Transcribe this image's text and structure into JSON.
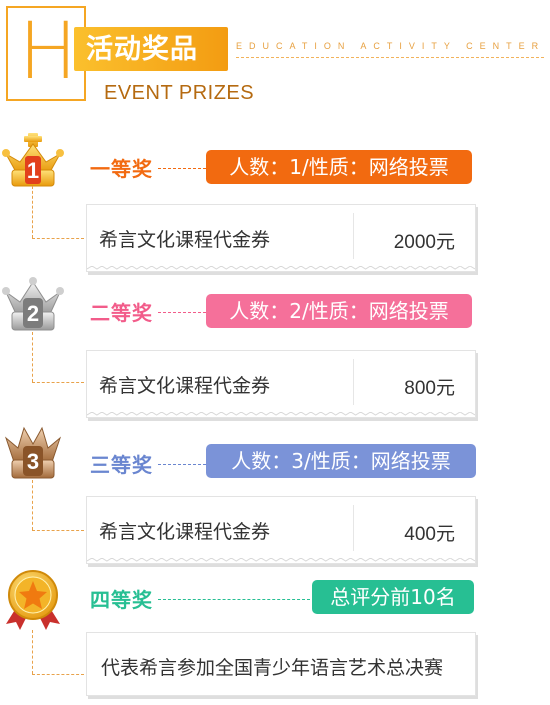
{
  "header": {
    "big_letter": "H",
    "title_cn": "活动奖品",
    "subtitle_en": "EDUCATION ACTIVITY CENTER",
    "event_en": "EVENT PRIZES"
  },
  "colors": {
    "accent": "#f5a623",
    "first": "#f26a10",
    "second": "#f25c8a",
    "third": "#6a86d0",
    "fourth": "#27bf93"
  },
  "prizes": [
    {
      "rank": "一等奖",
      "tag": "人数：1/性质：网络投票",
      "item": "希言文化课程代金券",
      "value": "2000元",
      "medal_number": "1",
      "medal_icon": "gold-crown-icon"
    },
    {
      "rank": "二等奖",
      "tag": "人数：2/性质：网络投票",
      "item": "希言文化课程代金券",
      "value": "800元",
      "medal_number": "2",
      "medal_icon": "silver-crown-icon"
    },
    {
      "rank": "三等奖",
      "tag": "人数：3/性质：网络投票",
      "item": "希言文化课程代金券",
      "value": "400元",
      "medal_number": "3",
      "medal_icon": "bronze-crown-icon"
    },
    {
      "rank": "四等奖",
      "tag": "总评分前10名",
      "item": "代表希言参加全国青少年语言艺术总决赛",
      "medal_icon": "star-medal-icon"
    }
  ]
}
